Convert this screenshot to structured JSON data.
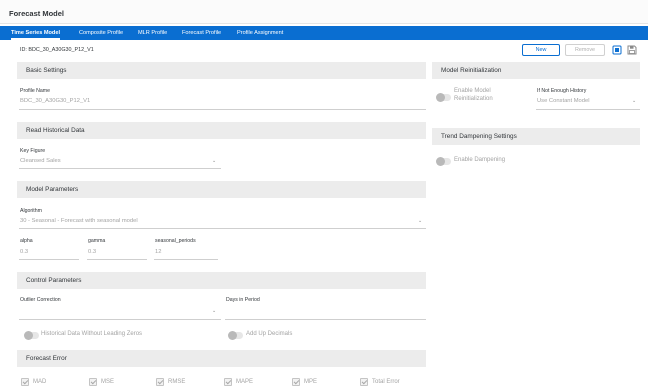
{
  "app": {
    "title": "Forecast Model"
  },
  "tabs": [
    {
      "label": "Time Series Model"
    },
    {
      "label": "Composite Profile"
    },
    {
      "label": "MLR Profile"
    },
    {
      "label": "Forecast Profile"
    },
    {
      "label": "Profile Assignment"
    }
  ],
  "header": {
    "id_text": "ID: BDC_30_A30G30_P12_V1",
    "new_label": "New",
    "remove_label": "Remove"
  },
  "basic": {
    "title": "Basic Settings",
    "profile_name_label": "Profile Name",
    "profile_name_value": "BDC_30_A30G30_P12_V1"
  },
  "history": {
    "title": "Read Historical Data",
    "key_figure_label": "Key Figure",
    "key_figure_value": "Cleansed Sales"
  },
  "model": {
    "title": "Model Parameters",
    "algorithm_label": "Algorithm",
    "algorithm_value": "30 - Seasonal - Forecast with seasonal model",
    "alpha_label": "alpha",
    "alpha_value": "0.3",
    "gamma_label": "gamma",
    "gamma_value": "0.3",
    "seasonal_label": "seasonal_periods",
    "seasonal_value": "12"
  },
  "control": {
    "title": "Control Parameters",
    "outlier_label": "Outlier Correction",
    "outlier_value": "",
    "days_label": "Days in Period",
    "days_value": "",
    "leading_zeros_label": "Historical Data Without Leading Zeros",
    "decimals_label": "Add Up Decimals"
  },
  "forecast_error": {
    "title": "Forecast Error",
    "items": [
      {
        "label": "MAD"
      },
      {
        "label": "MSE"
      },
      {
        "label": "RMSE"
      },
      {
        "label": "MAPE"
      },
      {
        "label": "MPE"
      },
      {
        "label": "Total Error"
      }
    ]
  },
  "reinit": {
    "title": "Model Reinitialization",
    "enable_label_1": "Enable Model",
    "enable_label_2": "Reinitialization",
    "not_enough_label": "If Not Enough History",
    "not_enough_value": "Use Constant Model"
  },
  "dampening": {
    "title": "Trend Dampening Settings",
    "enable_label": "Enable Dampening"
  },
  "colors": {
    "accent": "#0a6ed1",
    "section_bg": "#ececec",
    "disabled_text": "#a3a3a3"
  }
}
